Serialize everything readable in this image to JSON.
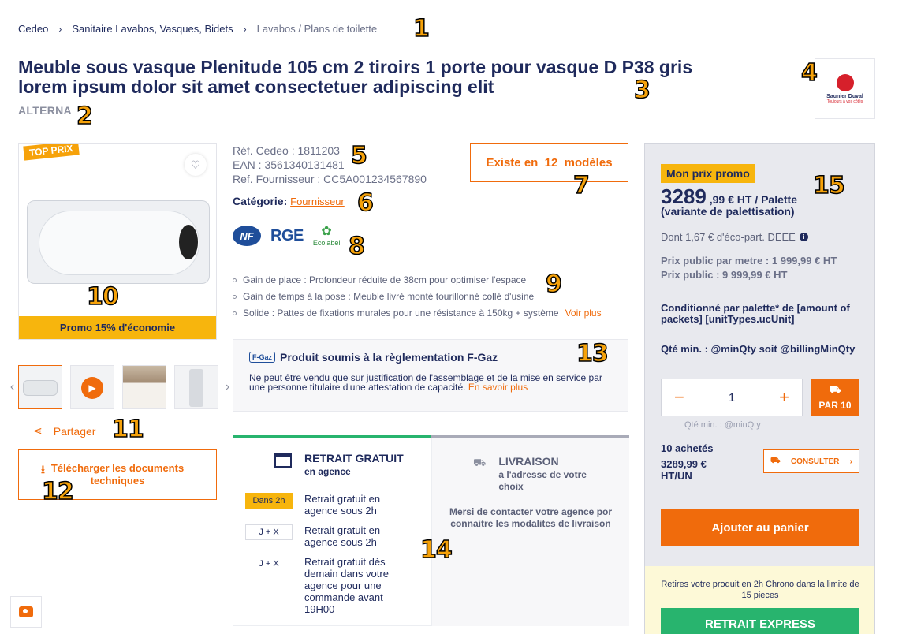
{
  "breadcrumb": {
    "items": [
      "Cedeo",
      "Sanitaire Lavabos, Vasques, Bidets",
      "Lavabos / Plans de toilette"
    ]
  },
  "product": {
    "title": "Meuble sous vasque Plenitude 105 cm 2 tiroirs 1 porte pour vasque D P38 gris lorem ipsum dolor sit amet consectetuer adipiscing elit",
    "brand": "ALTERNA",
    "brand_logo_text": "Saunier Duval",
    "brand_logo_tagline": "Toujours à vos côtés",
    "top_prix_label": "TOP PRIX",
    "promo_banner": "Promo 15% d'économie",
    "ref_cedeo": "Réf. Cedeo : 1811203",
    "ean": "EAN : 3561340131481",
    "ref_fournisseur": "Ref. Fournisseur : CC5A001234567890",
    "categorie_label": "Catégorie:",
    "categorie_value": "Fournisseur",
    "models_button": "Existe en  12  modèles",
    "certifications": [
      "NF",
      "RGE",
      "Ecolabel"
    ],
    "features": [
      "Gain de place : Profondeur réduite de 38cm pour optimiser l'espace",
      "Gain de temps à la pose : Meuble livré monté tourillonné collé d'usine",
      "Solide : Pattes de fixations murales pour une résistance à 150kg + système"
    ],
    "voir_plus": "Voir plus"
  },
  "gallery": {
    "share_label": "Partager",
    "download_label": "Télécharger les documents techniques"
  },
  "fgaz": {
    "logo": "F-Gaz",
    "title": "Produit soumis à la règlementation F-Gaz",
    "text": "Ne peut être vendu que sur justification de l'assemblage et de la mise en service par une personne titulaire d'une attestation de capacité.",
    "link": "En savoir plus"
  },
  "delivery": {
    "retrait_title": "RETRAIT GRATUIT",
    "retrait_sub": "en agence",
    "rows": [
      {
        "badge": "Dans 2h",
        "text": "Retrait gratuit en agence sous 2h"
      },
      {
        "badge": "J + X",
        "text": "Retrait gratuit en agence sous 2h"
      },
      {
        "badge": "J + X",
        "text": "Retrait gratuit dès demain dans votre agence pour une commande avant 19H00"
      }
    ],
    "livraison_title": "LIVRAISON",
    "livraison_sub": "a l'adresse de votre choix",
    "livraison_msg": "Mersi de contacter votre agence por connaitre les modalites de livraison"
  },
  "pricing": {
    "promo_tag": "Mon prix promo",
    "price_int": "3289",
    "price_dec": ",99 € HT / Palette",
    "price_variant": "(variante de palettisation)",
    "deee": "Dont 1,67 € d'éco-part. DEEE",
    "public_metre": "Prix public par metre : 1 999,99 € HT",
    "public": "Prix public : 9 999,99 € HT",
    "conditionne": "Conditionné par palette* de [amount of packets] [unitTypes.ucUnit]",
    "min_qty": "Qté min. : @minQty soit @billingMinQty",
    "quantity": "1",
    "par10": "PAR 10",
    "qty_min_hint": "Qté min. : @minQty",
    "achetes": "10 achetés",
    "unit_price": "3289,99 € HT/UN",
    "consulter": "CONSULTER",
    "add_to_cart": "Ajouter au panier",
    "chrono_text": "Retires votre produit en 2h Chrono dans la limite de 15 pieces",
    "express": "RETRAIT EXPRESS"
  },
  "markers": [
    "1",
    "2",
    "3",
    "4",
    "5",
    "6",
    "7",
    "8",
    "9",
    "10",
    "11",
    "12",
    "13",
    "14",
    "15"
  ],
  "colors": {
    "accent": "#f06b0c",
    "navy": "#1f2a5c",
    "promo": "#f7b50d",
    "green": "#28b46e"
  }
}
